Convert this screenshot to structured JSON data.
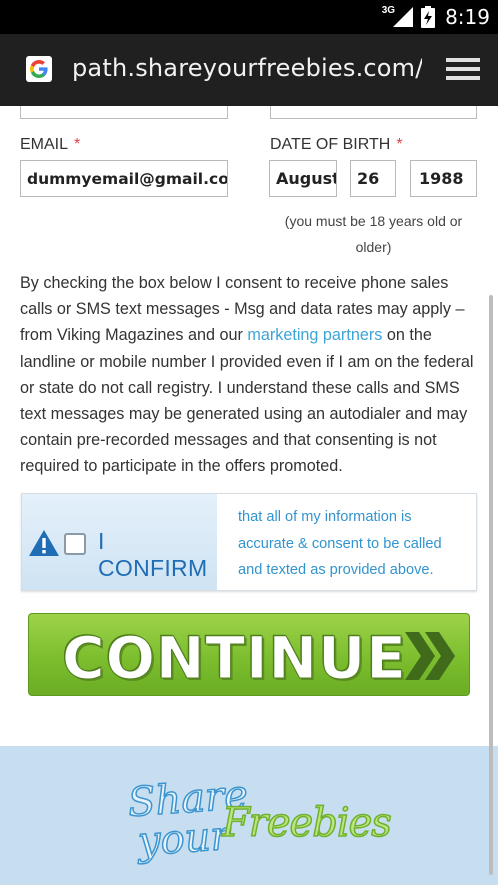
{
  "status_bar": {
    "network": "3G",
    "time": "8:19"
  },
  "browser": {
    "url": "path.shareyourfreebies.com/?tr",
    "site_icon": "google-g-icon",
    "menu_icon": "tab-switcher-icon"
  },
  "form": {
    "email": {
      "label": "EMAIL",
      "required_mark": "*",
      "value": "dummyemail@gmail.com"
    },
    "dob": {
      "label": "DATE OF BIRTH",
      "required_mark": "*",
      "month": "August",
      "day": "26",
      "year": "1988",
      "note": "(you must be 18 years old or older)"
    },
    "consent": {
      "text_before_link": "By checking the box below I consent to receive phone sales calls or SMS text messages - Msg and data rates may apply – from Viking Magazines and our ",
      "link_text": "marketing partners",
      "text_after_link": " on the landline or mobile number I provided even if I am on the federal or state do not call registry. I understand these calls and SMS text messages may be generated using an autodialer and may contain pre-recorded messages and that consenting is not required to participate in the offers promoted."
    },
    "confirm": {
      "label": "I CONFIRM",
      "description": "that all of my information is accurate & consent to be called and texted as provided above.",
      "checked": false,
      "icon": "warning-icon"
    },
    "continue_label": "CONTINUE"
  },
  "footer": {
    "logo": {
      "share": "Share",
      "your": "your",
      "freebies": "Freebies"
    }
  },
  "colors": {
    "required": "#e2414b",
    "link": "#3da4d6",
    "confirm_label": "#1f6db5",
    "continue_green": "#7cbe2e",
    "footer_bg": "#c6def0"
  }
}
